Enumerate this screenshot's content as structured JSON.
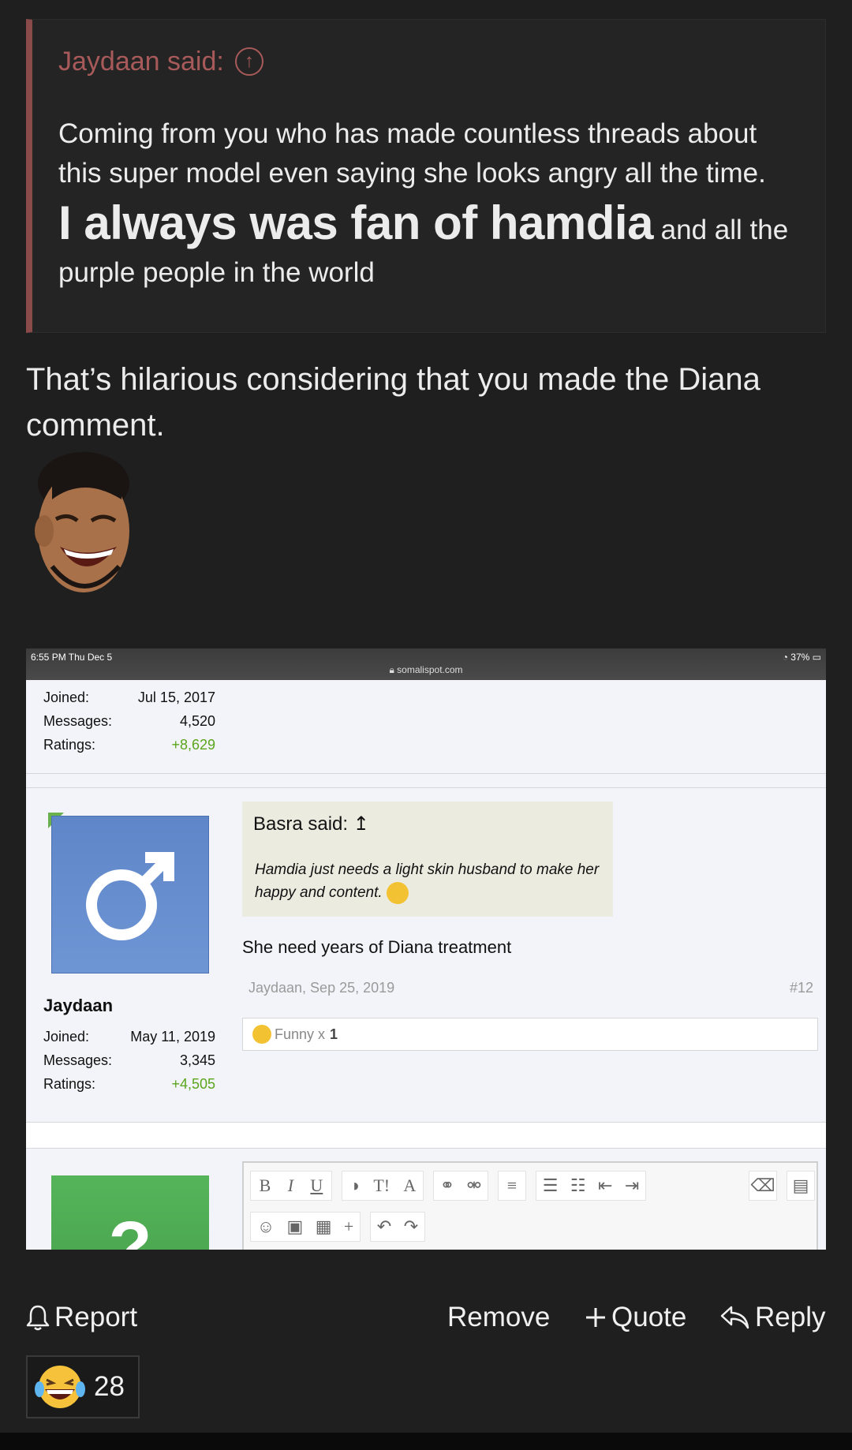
{
  "quote": {
    "author": "Jaydaan said:",
    "line1": "Coming from you who has made countless threads about this super model even saying she looks angry all the time.",
    "big": "I always was fan of hamdia",
    "tail": " and all the purple people in the world"
  },
  "post": {
    "text": "That’s hilarious considering that you made the Diana comment."
  },
  "screenshot": {
    "status_time": "6:55 PM  Thu Dec 5",
    "status_battery": "37%",
    "url": "somalispot.com",
    "top_stats": [
      {
        "label": "Joined:",
        "value": "Jul 15, 2017"
      },
      {
        "label": "Messages:",
        "value": "4,520"
      },
      {
        "label": "Ratings:",
        "value": "+8,629"
      }
    ],
    "quote_head": "Basra said:",
    "quote_body": "Hamdia just needs a light skin husband to make her happy and content.",
    "reply": "She need years of Diana treatment",
    "meta": "Jaydaan, Sep 25, 2019",
    "post_num": "#12",
    "funny_label": "Funny x",
    "funny_count": "1",
    "user": "Jaydaan",
    "user_stats": [
      {
        "label": "Joined:",
        "value": "May 11, 2019"
      },
      {
        "label": "Messages:",
        "value": "3,345"
      },
      {
        "label": "Ratings:",
        "value": "+4,505"
      }
    ],
    "avatar2_glyph": "?",
    "toolbar_icons": [
      "bold-icon",
      "italic-icon",
      "underline-icon",
      "contrast-icon",
      "text-size-icon",
      "font-icon",
      "link-icon",
      "unlink-icon",
      "align-left-icon",
      "bullet-list-icon",
      "numbered-list-icon",
      "outdent-icon",
      "indent-icon",
      "eraser-icon",
      "document-icon",
      "smiley-icon",
      "image-icon",
      "media-icon",
      "plus-icon",
      "undo-icon",
      "redo-icon"
    ]
  },
  "actions": {
    "report": "Report",
    "remove": "Remove",
    "quote": "Quote",
    "reply": "Reply"
  },
  "reaction": {
    "count": "28",
    "icon": "laughing-crying-emoji-icon"
  }
}
